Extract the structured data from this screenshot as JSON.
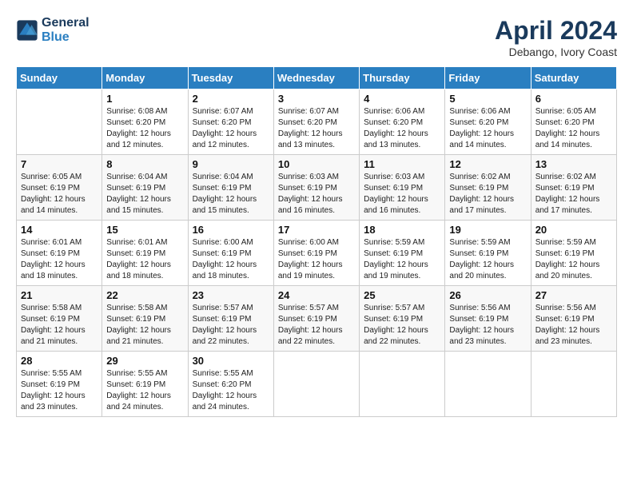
{
  "header": {
    "logo_line1": "General",
    "logo_line2": "Blue",
    "month": "April 2024",
    "location": "Debango, Ivory Coast"
  },
  "days_of_week": [
    "Sunday",
    "Monday",
    "Tuesday",
    "Wednesday",
    "Thursday",
    "Friday",
    "Saturday"
  ],
  "weeks": [
    [
      {
        "day": "",
        "info": ""
      },
      {
        "day": "1",
        "info": "Sunrise: 6:08 AM\nSunset: 6:20 PM\nDaylight: 12 hours\nand 12 minutes."
      },
      {
        "day": "2",
        "info": "Sunrise: 6:07 AM\nSunset: 6:20 PM\nDaylight: 12 hours\nand 12 minutes."
      },
      {
        "day": "3",
        "info": "Sunrise: 6:07 AM\nSunset: 6:20 PM\nDaylight: 12 hours\nand 13 minutes."
      },
      {
        "day": "4",
        "info": "Sunrise: 6:06 AM\nSunset: 6:20 PM\nDaylight: 12 hours\nand 13 minutes."
      },
      {
        "day": "5",
        "info": "Sunrise: 6:06 AM\nSunset: 6:20 PM\nDaylight: 12 hours\nand 14 minutes."
      },
      {
        "day": "6",
        "info": "Sunrise: 6:05 AM\nSunset: 6:20 PM\nDaylight: 12 hours\nand 14 minutes."
      }
    ],
    [
      {
        "day": "7",
        "info": "Sunrise: 6:05 AM\nSunset: 6:19 PM\nDaylight: 12 hours\nand 14 minutes."
      },
      {
        "day": "8",
        "info": "Sunrise: 6:04 AM\nSunset: 6:19 PM\nDaylight: 12 hours\nand 15 minutes."
      },
      {
        "day": "9",
        "info": "Sunrise: 6:04 AM\nSunset: 6:19 PM\nDaylight: 12 hours\nand 15 minutes."
      },
      {
        "day": "10",
        "info": "Sunrise: 6:03 AM\nSunset: 6:19 PM\nDaylight: 12 hours\nand 16 minutes."
      },
      {
        "day": "11",
        "info": "Sunrise: 6:03 AM\nSunset: 6:19 PM\nDaylight: 12 hours\nand 16 minutes."
      },
      {
        "day": "12",
        "info": "Sunrise: 6:02 AM\nSunset: 6:19 PM\nDaylight: 12 hours\nand 17 minutes."
      },
      {
        "day": "13",
        "info": "Sunrise: 6:02 AM\nSunset: 6:19 PM\nDaylight: 12 hours\nand 17 minutes."
      }
    ],
    [
      {
        "day": "14",
        "info": "Sunrise: 6:01 AM\nSunset: 6:19 PM\nDaylight: 12 hours\nand 18 minutes."
      },
      {
        "day": "15",
        "info": "Sunrise: 6:01 AM\nSunset: 6:19 PM\nDaylight: 12 hours\nand 18 minutes."
      },
      {
        "day": "16",
        "info": "Sunrise: 6:00 AM\nSunset: 6:19 PM\nDaylight: 12 hours\nand 18 minutes."
      },
      {
        "day": "17",
        "info": "Sunrise: 6:00 AM\nSunset: 6:19 PM\nDaylight: 12 hours\nand 19 minutes."
      },
      {
        "day": "18",
        "info": "Sunrise: 5:59 AM\nSunset: 6:19 PM\nDaylight: 12 hours\nand 19 minutes."
      },
      {
        "day": "19",
        "info": "Sunrise: 5:59 AM\nSunset: 6:19 PM\nDaylight: 12 hours\nand 20 minutes."
      },
      {
        "day": "20",
        "info": "Sunrise: 5:59 AM\nSunset: 6:19 PM\nDaylight: 12 hours\nand 20 minutes."
      }
    ],
    [
      {
        "day": "21",
        "info": "Sunrise: 5:58 AM\nSunset: 6:19 PM\nDaylight: 12 hours\nand 21 minutes."
      },
      {
        "day": "22",
        "info": "Sunrise: 5:58 AM\nSunset: 6:19 PM\nDaylight: 12 hours\nand 21 minutes."
      },
      {
        "day": "23",
        "info": "Sunrise: 5:57 AM\nSunset: 6:19 PM\nDaylight: 12 hours\nand 22 minutes."
      },
      {
        "day": "24",
        "info": "Sunrise: 5:57 AM\nSunset: 6:19 PM\nDaylight: 12 hours\nand 22 minutes."
      },
      {
        "day": "25",
        "info": "Sunrise: 5:57 AM\nSunset: 6:19 PM\nDaylight: 12 hours\nand 22 minutes."
      },
      {
        "day": "26",
        "info": "Sunrise: 5:56 AM\nSunset: 6:19 PM\nDaylight: 12 hours\nand 23 minutes."
      },
      {
        "day": "27",
        "info": "Sunrise: 5:56 AM\nSunset: 6:19 PM\nDaylight: 12 hours\nand 23 minutes."
      }
    ],
    [
      {
        "day": "28",
        "info": "Sunrise: 5:55 AM\nSunset: 6:19 PM\nDaylight: 12 hours\nand 23 minutes."
      },
      {
        "day": "29",
        "info": "Sunrise: 5:55 AM\nSunset: 6:19 PM\nDaylight: 12 hours\nand 24 minutes."
      },
      {
        "day": "30",
        "info": "Sunrise: 5:55 AM\nSunset: 6:20 PM\nDaylight: 12 hours\nand 24 minutes."
      },
      {
        "day": "",
        "info": ""
      },
      {
        "day": "",
        "info": ""
      },
      {
        "day": "",
        "info": ""
      },
      {
        "day": "",
        "info": ""
      }
    ]
  ]
}
